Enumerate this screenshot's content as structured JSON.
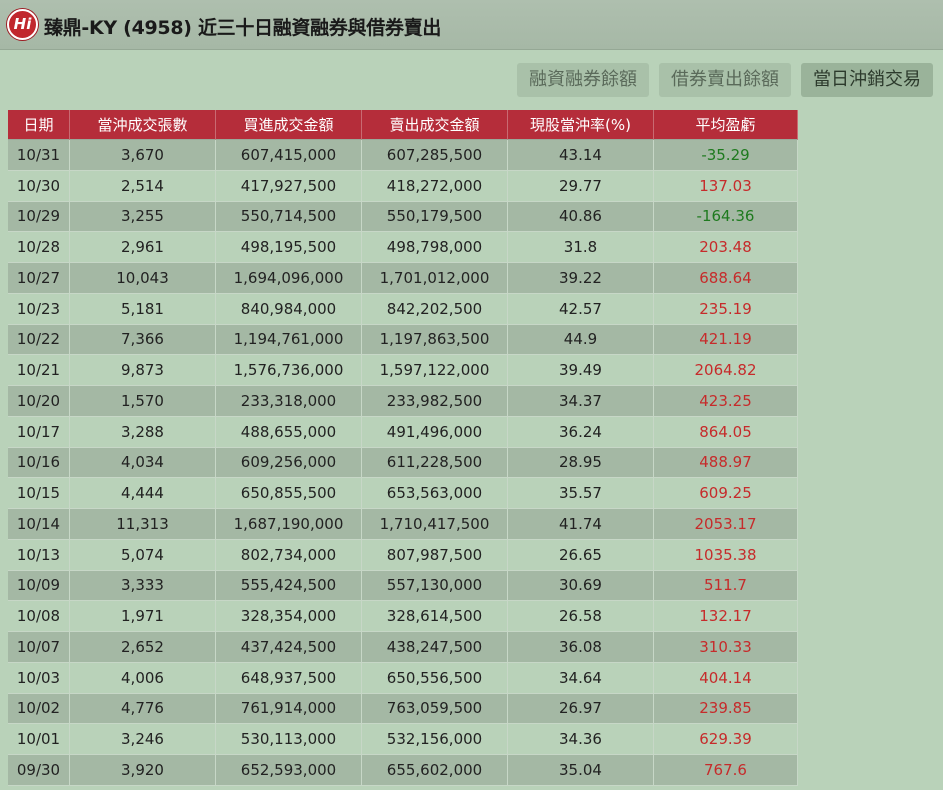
{
  "header": {
    "logo_text": "Hi",
    "title": "臻鼎-KY (4958) 近三十日融資融券與借券賣出"
  },
  "tabs": [
    {
      "label": "融資融券餘額",
      "active": false
    },
    {
      "label": "借券賣出餘額",
      "active": false
    },
    {
      "label": "當日沖銷交易",
      "active": true
    }
  ],
  "table": {
    "columns": [
      "日期",
      "當沖成交張數",
      "買進成交金額",
      "賣出成交金額",
      "現股當沖率(%)",
      "平均盈虧"
    ],
    "rows": [
      [
        "10/31",
        "3,670",
        "607,415,000",
        "607,285,500",
        "43.14",
        "-35.29"
      ],
      [
        "10/30",
        "2,514",
        "417,927,500",
        "418,272,000",
        "29.77",
        "137.03"
      ],
      [
        "10/29",
        "3,255",
        "550,714,500",
        "550,179,500",
        "40.86",
        "-164.36"
      ],
      [
        "10/28",
        "2,961",
        "498,195,500",
        "498,798,000",
        "31.8",
        "203.48"
      ],
      [
        "10/27",
        "10,043",
        "1,694,096,000",
        "1,701,012,000",
        "39.22",
        "688.64"
      ],
      [
        "10/23",
        "5,181",
        "840,984,000",
        "842,202,500",
        "42.57",
        "235.19"
      ],
      [
        "10/22",
        "7,366",
        "1,194,761,000",
        "1,197,863,500",
        "44.9",
        "421.19"
      ],
      [
        "10/21",
        "9,873",
        "1,576,736,000",
        "1,597,122,000",
        "39.49",
        "2064.82"
      ],
      [
        "10/20",
        "1,570",
        "233,318,000",
        "233,982,500",
        "34.37",
        "423.25"
      ],
      [
        "10/17",
        "3,288",
        "488,655,000",
        "491,496,000",
        "36.24",
        "864.05"
      ],
      [
        "10/16",
        "4,034",
        "609,256,000",
        "611,228,500",
        "28.95",
        "488.97"
      ],
      [
        "10/15",
        "4,444",
        "650,855,500",
        "653,563,000",
        "35.57",
        "609.25"
      ],
      [
        "10/14",
        "11,313",
        "1,687,190,000",
        "1,710,417,500",
        "41.74",
        "2053.17"
      ],
      [
        "10/13",
        "5,074",
        "802,734,000",
        "807,987,500",
        "26.65",
        "1035.38"
      ],
      [
        "10/09",
        "3,333",
        "555,424,500",
        "557,130,000",
        "30.69",
        "511.7"
      ],
      [
        "10/08",
        "1,971",
        "328,354,000",
        "328,614,500",
        "26.58",
        "132.17"
      ],
      [
        "10/07",
        "2,652",
        "437,424,500",
        "438,247,500",
        "36.08",
        "310.33"
      ],
      [
        "10/03",
        "4,006",
        "648,937,500",
        "650,556,500",
        "34.64",
        "404.14"
      ],
      [
        "10/02",
        "4,776",
        "761,914,000",
        "763,059,500",
        "26.97",
        "239.85"
      ],
      [
        "10/01",
        "3,246",
        "530,113,000",
        "532,156,000",
        "34.36",
        "629.39"
      ],
      [
        "09/30",
        "3,920",
        "652,593,000",
        "655,602,000",
        "35.04",
        "767.6"
      ]
    ]
  },
  "colors": {
    "header_bg": "#b52d3a",
    "positive": "#c62b2b",
    "negative": "#1e7a1e",
    "page_bg": "#b9d2b9"
  }
}
